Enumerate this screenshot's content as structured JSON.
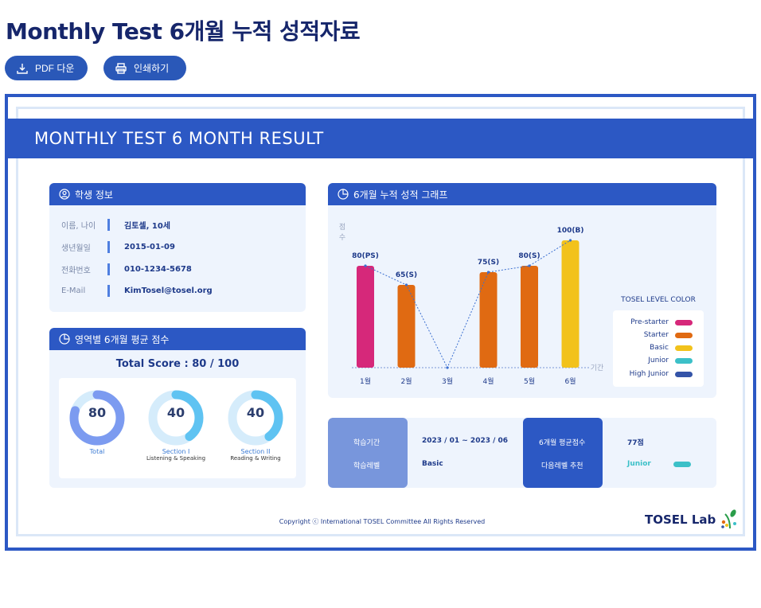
{
  "page": {
    "title": "Monthly Test 6개월 누적 성적자료",
    "pdf_label": "PDF 다운",
    "print_label": "인쇄하기"
  },
  "report": {
    "header": "MONTHLY TEST 6 MONTH RESULT",
    "student": {
      "title": "학생 정보",
      "rows": [
        {
          "label": "이름, 나이",
          "value": "김토셀, 10세"
        },
        {
          "label": "생년월일",
          "value": "2015-01-09"
        },
        {
          "label": "전화번호",
          "value": "010-1234-5678"
        },
        {
          "label": "E-Mail",
          "value": "KimTosel@tosel.org"
        }
      ]
    },
    "scores": {
      "title": "영역별 6개월 평균 점수",
      "total": "Total Score : 80 / 100",
      "gauges": [
        {
          "value": "80",
          "fraction": 0.8,
          "caption": "Total",
          "sub": ""
        },
        {
          "value": "40",
          "fraction": 0.4,
          "caption": "Section I",
          "sub": "Listening & Speaking"
        },
        {
          "value": "40",
          "fraction": 0.4,
          "caption": "Section II",
          "sub": "Reading & Writing"
        }
      ]
    },
    "graph": {
      "title": "6개월 누적 성적 그래프",
      "ylabel": "점수",
      "xlabel": "기간"
    },
    "legend": {
      "title": "TOSEL LEVEL COLOR",
      "items": [
        {
          "label": "Pre-starter",
          "color": "#d6287a"
        },
        {
          "label": "Starter",
          "color": "#e06a12"
        },
        {
          "label": "Basic",
          "color": "#f2c21b"
        },
        {
          "label": "Junior",
          "color": "#3cc0c8"
        },
        {
          "label": "High Junior",
          "color": "#3454a8"
        }
      ]
    },
    "summary": {
      "period_label": "학습기간",
      "period_value": "2023 / 01 ~ 2023 / 06",
      "level_label": "학습레벨",
      "level_value": "Basic",
      "avg_label": "6개월 평균점수",
      "avg_value": "77점",
      "next_label": "다음레벨 추천",
      "next_value": "Junior",
      "next_color": "#3cc0c8"
    },
    "footer": {
      "copyright": "Copyright ⓒ International TOSEL Committee All Rights Reserved",
      "brand": "TOSEL Lab"
    }
  },
  "chart_data": {
    "type": "bar",
    "categories": [
      "1월",
      "2월",
      "3월",
      "4월",
      "5월",
      "6월"
    ],
    "values": [
      80,
      65,
      0,
      75,
      80,
      100
    ],
    "labels": [
      "80(PS)",
      "65(S)",
      "",
      "75(S)",
      "80(S)",
      "100(B)"
    ],
    "colors": [
      "#d6287a",
      "#e06a12",
      "",
      "#e06a12",
      "#e06a12",
      "#f2c21b"
    ],
    "ylabel": "점수",
    "xlabel": "기간",
    "ylim": [
      0,
      100
    ],
    "trend_line": "dotted"
  }
}
